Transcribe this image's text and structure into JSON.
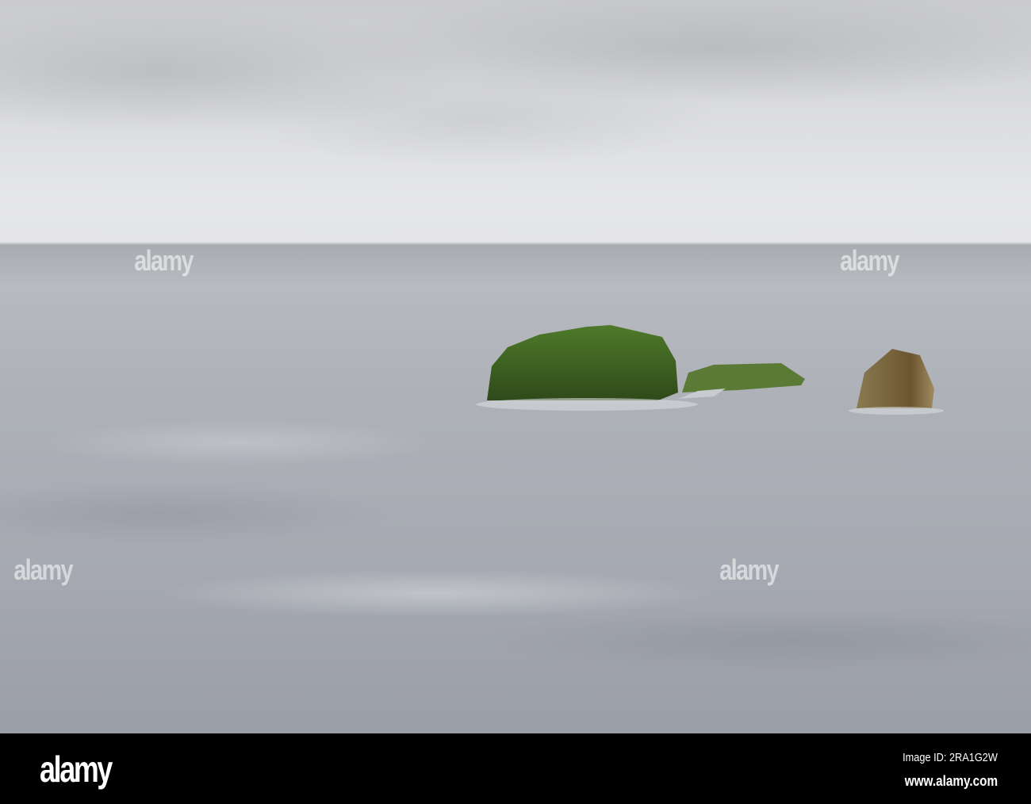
{
  "photo": {
    "description_alt": "",
    "watermark": "alamy"
  },
  "footer": {
    "logo": "alamy",
    "image_id": "Image ID: 2RA1G2W",
    "url": "www.alamy.com"
  }
}
